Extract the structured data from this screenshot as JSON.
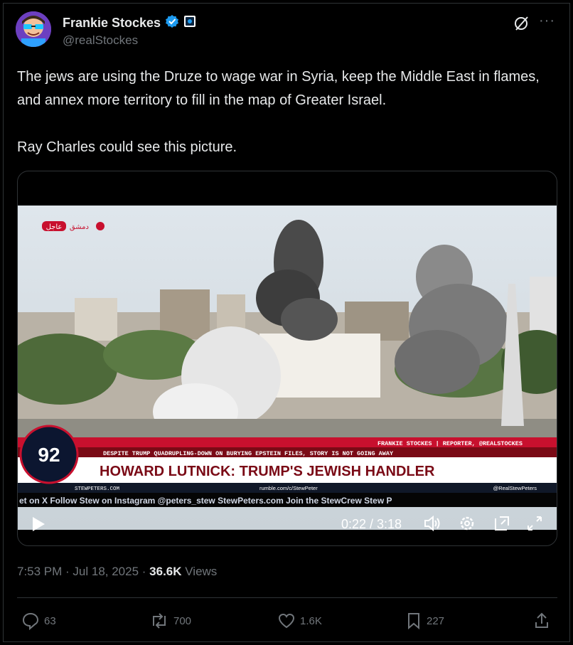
{
  "author": {
    "name": "Frankie Stockes",
    "handle": "@realStockes"
  },
  "tweet": {
    "text_line1": "The jews are using the Druze to wage war in Syria, keep the Middle East in flames, and annex more territory to fill in the map of Greater Israel.",
    "text_line2": "Ray Charles could see this picture."
  },
  "video": {
    "corner_tag": "عاجل",
    "corner_city": "دمشق",
    "logo": "92",
    "banner_top": "FRANKIE STOCKES | REPORTER, @REALSTOCKES",
    "subheadline": "DESPITE TRUMP QUADRUPLING-DOWN ON BURYING EPSTEIN FILES, STORY IS NOT GOING AWAY",
    "headline": "HOWARD LUTNICK: TRUMP'S JEWISH HANDLER",
    "footer_left": "STEWPETERS.COM",
    "footer_mid": "rumble.com/c/StewPeter",
    "footer_right": "@RealStewPeters",
    "ticker": "et on X   Follow Stew on Instagram @peters_stew   StewPeters.com   Join the StewCrew   Stew P",
    "time_display": "0:22 / 3:18"
  },
  "meta": {
    "time": "7:53 PM · Jul 18, 2025 · ",
    "views_count": "36.6K",
    "views_label": " Views"
  },
  "actions": {
    "replies": "63",
    "reposts": "700",
    "likes": "1.6K",
    "bookmarks": "227"
  },
  "colors": {
    "background": "#000000",
    "verified": "#1d9bf0",
    "muted": "#71767b",
    "banner_red": "#c8102e"
  }
}
